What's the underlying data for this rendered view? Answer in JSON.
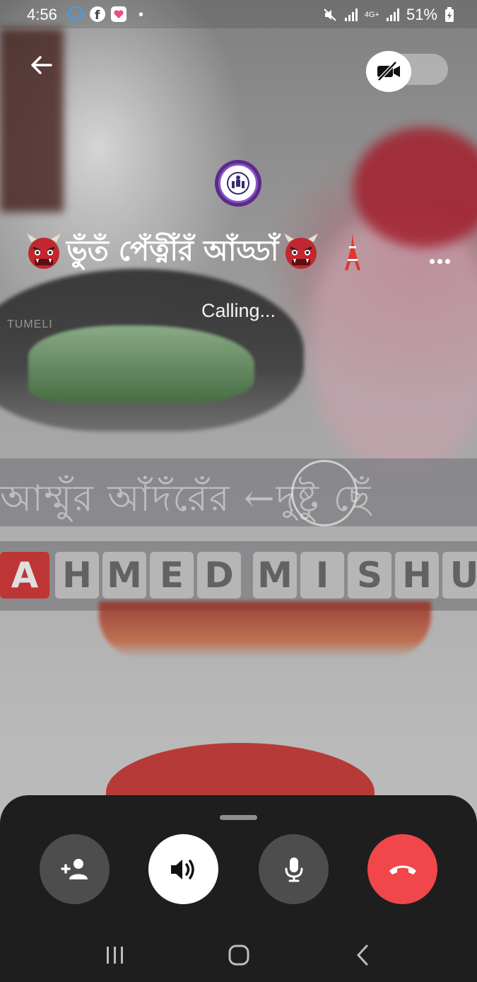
{
  "status_bar": {
    "time": "4:56",
    "network": "4G+",
    "battery": "51%",
    "icons": [
      "imo-icon",
      "facebook-icon",
      "gallery-icon",
      "mute-icon",
      "signal-icon",
      "battery-charging-icon"
    ]
  },
  "background_photo": {
    "banner_text": "আম্মুঁর আঁদঁরেঁর ←দুষ্টু ছেঁ",
    "name_tiles": [
      "A",
      "H",
      "M",
      "E",
      "D",
      "M",
      "I",
      "S",
      "H",
      "U"
    ],
    "watermark": "TUMELI"
  },
  "call": {
    "group_name": "ভুঁতঁ পেঁত্নীঁরঁ আঁড্ডাঁ",
    "status": "Calling..."
  },
  "colors": {
    "end_call": "#f1474a",
    "control_gray": "#4d4d4d",
    "sheet": "#1e1e1e",
    "avatar_ring": "#8a54c8"
  },
  "controls": [
    "add-person-icon",
    "speaker-icon",
    "microphone-icon",
    "end-call-icon"
  ]
}
